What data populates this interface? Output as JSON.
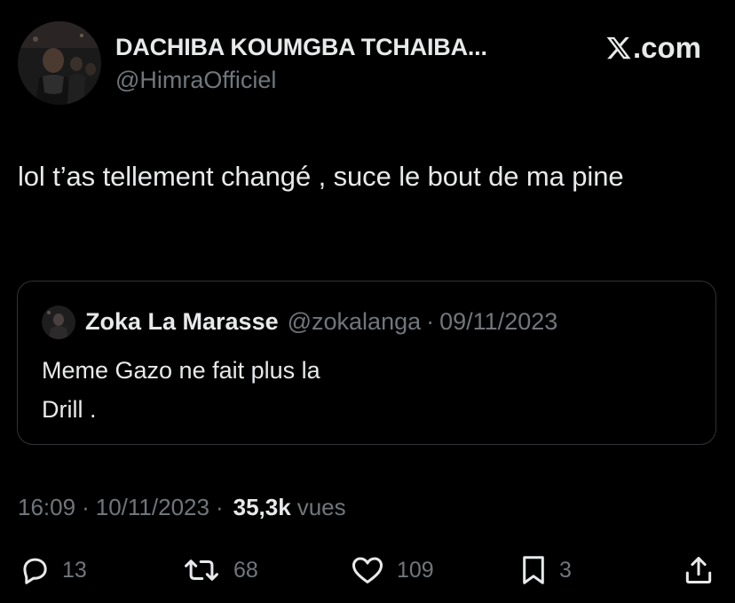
{
  "author": {
    "display_name": "DACHIBA KOUMGBA TCHAIBA...",
    "handle": "@HimraOfficiel",
    "avatar_icon": "profile-avatar"
  },
  "brand": {
    "text": ".com",
    "logo_icon": "x-logo-icon"
  },
  "tweet": {
    "text": "lol t’as tellement changé , suce le bout de ma pine"
  },
  "quoted_tweet": {
    "display_name": "Zoka La Marasse",
    "handle": "@zokalanga",
    "separator": "·",
    "date": "09/11/2023",
    "text_line1": "Meme Gazo ne fait plus la",
    "text_line2": "Drill ."
  },
  "meta": {
    "time": "16:09",
    "separator": "·",
    "date": "10/11/2023",
    "separator2": "·",
    "views_count": "35,3k",
    "views_label": "vues"
  },
  "actions": {
    "replies": "13",
    "retweets": "68",
    "likes": "109",
    "bookmarks": "3"
  },
  "colors": {
    "background": "#000000",
    "primary_text": "#e7e9ea",
    "secondary_text": "#71767b",
    "border": "#2f3336"
  }
}
